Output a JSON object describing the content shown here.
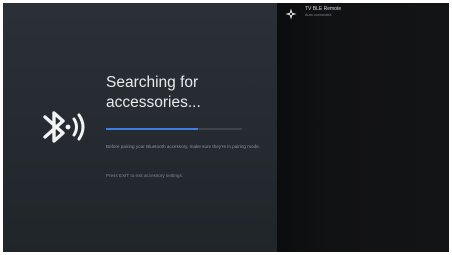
{
  "screen": {
    "title": "Searching for accessories...",
    "instruction": "Before pairing your Bluetooth accessory, make sure they're in pairing mode.",
    "exit_hint": "Press EXIT to exit accessory settings.",
    "progress_fraction": 0.68,
    "bluetooth_icon": "bluetooth-searching-icon"
  },
  "devices": [
    {
      "name": "TV BLE Remote",
      "status": "Auto connected",
      "icon": "gamepad-icon"
    }
  ],
  "colors": {
    "left_panel": "#262c31",
    "right_panel": "#121315",
    "progress_fill": "#3d7ee0",
    "title_text": "#e8eaec"
  }
}
